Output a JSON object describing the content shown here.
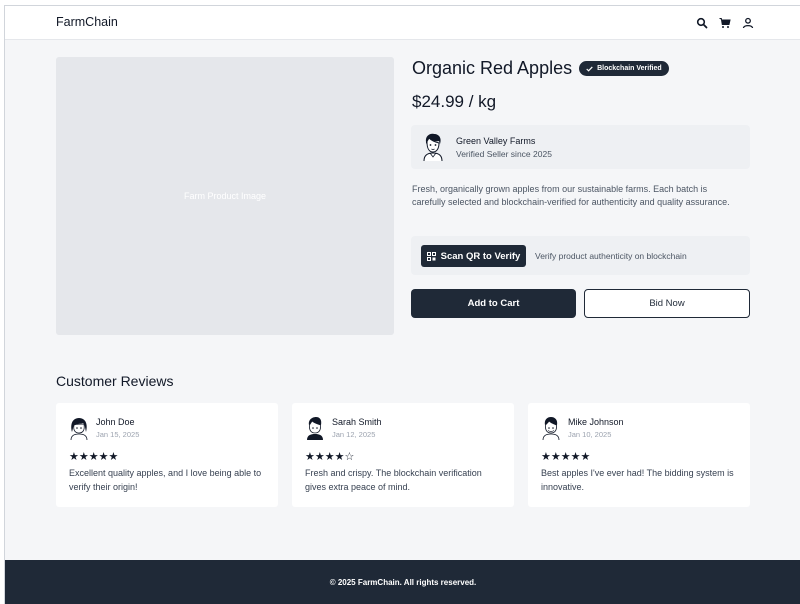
{
  "header": {
    "brand": "FarmChain",
    "icons": [
      "search-icon",
      "cart-icon",
      "user-icon"
    ]
  },
  "product": {
    "image_placeholder": "Farm Product Image",
    "title": "Organic Red Apples",
    "badge": "Blockchain Verified",
    "price": "$24.99 / kg",
    "seller": {
      "name": "Green Valley Farms",
      "subtitle": "Verified Seller since 2025"
    },
    "description": "Fresh, organically grown apples from our sustainable farms. Each batch is carefully selected and blockchain-verified for authenticity and quality assurance.",
    "qr": {
      "button_label": "Scan QR to Verify",
      "hint": "Verify product authenticity on blockchain"
    },
    "add_to_cart_label": "Add to Cart",
    "bid_label": "Bid Now"
  },
  "reviews": {
    "title": "Customer Reviews",
    "items": [
      {
        "name": "John Doe",
        "date": "Jan 15, 2025",
        "stars": "★★★★★",
        "text": "Excellent quality apples, and I love being able to verify their origin!"
      },
      {
        "name": "Sarah Smith",
        "date": "Jan 12, 2025",
        "stars": "★★★★☆",
        "text": "Fresh and crispy. The blockchain verification gives extra peace of mind."
      },
      {
        "name": "Mike Johnson",
        "date": "Jan 10, 2025",
        "stars": "★★★★★",
        "text": "Best apples I've ever had! The bidding system is innovative."
      }
    ]
  },
  "footer": {
    "copyright": "© 2025 FarmChain. All rights reserved."
  },
  "colors": {
    "primary": "#1f2937",
    "background": "#f5f6f8",
    "panel": "#eef0f3",
    "placeholder": "#e5e7eb"
  }
}
